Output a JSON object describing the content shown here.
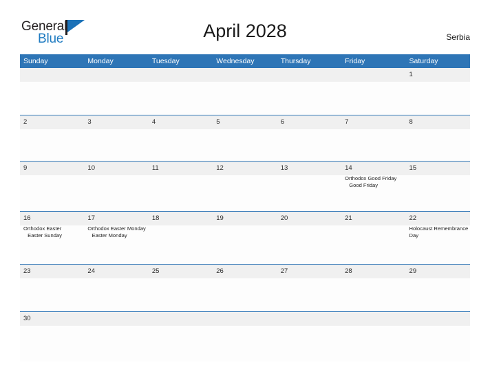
{
  "brand": {
    "word_one": "General",
    "word_two": "Blue",
    "flag_icon": "general-blue-flag-logo"
  },
  "header": {
    "title": "April 2028",
    "country": "Serbia"
  },
  "colors": {
    "header_blue": "#2e75b6",
    "row_separator_blue": "#2e75b6",
    "day_strip_gray": "#f0f0f0",
    "brand_blue": "#1f7bc1",
    "text_dark": "#231f20"
  },
  "calendar": {
    "weekdays": [
      "Sunday",
      "Monday",
      "Tuesday",
      "Wednesday",
      "Thursday",
      "Friday",
      "Saturday"
    ],
    "weeks": [
      {
        "days": [
          {
            "num": "",
            "holidays": []
          },
          {
            "num": "",
            "holidays": []
          },
          {
            "num": "",
            "holidays": []
          },
          {
            "num": "",
            "holidays": []
          },
          {
            "num": "",
            "holidays": []
          },
          {
            "num": "",
            "holidays": []
          },
          {
            "num": "1",
            "holidays": []
          }
        ]
      },
      {
        "days": [
          {
            "num": "2",
            "holidays": []
          },
          {
            "num": "3",
            "holidays": []
          },
          {
            "num": "4",
            "holidays": []
          },
          {
            "num": "5",
            "holidays": []
          },
          {
            "num": "6",
            "holidays": []
          },
          {
            "num": "7",
            "holidays": []
          },
          {
            "num": "8",
            "holidays": []
          }
        ]
      },
      {
        "days": [
          {
            "num": "9",
            "holidays": []
          },
          {
            "num": "10",
            "holidays": []
          },
          {
            "num": "11",
            "holidays": []
          },
          {
            "num": "12",
            "holidays": []
          },
          {
            "num": "13",
            "holidays": []
          },
          {
            "num": "14",
            "holidays": [
              "Orthodox Good Friday",
              " Good Friday"
            ]
          },
          {
            "num": "15",
            "holidays": []
          }
        ]
      },
      {
        "days": [
          {
            "num": "16",
            "holidays": [
              "Orthodox Easter",
              " Easter Sunday"
            ]
          },
          {
            "num": "17",
            "holidays": [
              "Orthodox Easter Monday",
              " Easter Monday"
            ]
          },
          {
            "num": "18",
            "holidays": []
          },
          {
            "num": "19",
            "holidays": []
          },
          {
            "num": "20",
            "holidays": []
          },
          {
            "num": "21",
            "holidays": []
          },
          {
            "num": "22",
            "holidays": [
              "Holocaust Remembrance Day"
            ]
          }
        ]
      },
      {
        "days": [
          {
            "num": "23",
            "holidays": []
          },
          {
            "num": "24",
            "holidays": []
          },
          {
            "num": "25",
            "holidays": []
          },
          {
            "num": "26",
            "holidays": []
          },
          {
            "num": "27",
            "holidays": []
          },
          {
            "num": "28",
            "holidays": []
          },
          {
            "num": "29",
            "holidays": []
          }
        ]
      },
      {
        "days": [
          {
            "num": "30",
            "holidays": []
          },
          {
            "num": "",
            "holidays": []
          },
          {
            "num": "",
            "holidays": []
          },
          {
            "num": "",
            "holidays": []
          },
          {
            "num": "",
            "holidays": []
          },
          {
            "num": "",
            "holidays": []
          },
          {
            "num": "",
            "holidays": []
          }
        ]
      }
    ]
  }
}
